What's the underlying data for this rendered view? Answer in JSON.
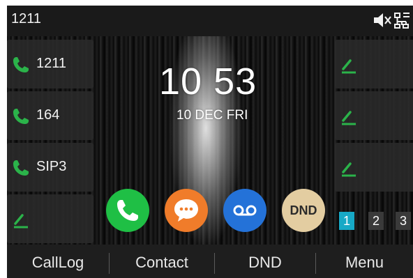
{
  "status_bar": {
    "title": "1211",
    "icons": [
      "mute-icon",
      "network-icon"
    ]
  },
  "line_keys_left": [
    {
      "label": "1211",
      "icon": "phone-icon",
      "color": "#2bb34a"
    },
    {
      "label": "164",
      "icon": "phone-icon",
      "color": "#2bb34a"
    },
    {
      "label": "SIP3",
      "icon": "phone-icon",
      "color": "#2bb34a"
    },
    {
      "label": "",
      "icon": "edit-icon",
      "color": "#2bb34a"
    }
  ],
  "line_keys_right": [
    {
      "label": "",
      "icon": "edit-icon"
    },
    {
      "label": "",
      "icon": "edit-icon"
    },
    {
      "label": "",
      "icon": "edit-icon"
    }
  ],
  "clock": {
    "time": "10 53",
    "date": "10 DEC FRI"
  },
  "apps": [
    {
      "name": "call",
      "icon": "phone-icon",
      "color": "#1fbf45"
    },
    {
      "name": "message",
      "icon": "message-icon",
      "color": "#f07c2a"
    },
    {
      "name": "voicemail",
      "icon": "voicemail-icon",
      "color": "#2472d8"
    },
    {
      "name": "dnd",
      "label": "DND",
      "color": "#e3cda1"
    }
  ],
  "pages": {
    "items": [
      "1",
      "2",
      "3"
    ],
    "active": "1",
    "active_color": "#17a9c6"
  },
  "softkeys": [
    "CallLog",
    "Contact",
    "DND",
    "Menu"
  ]
}
